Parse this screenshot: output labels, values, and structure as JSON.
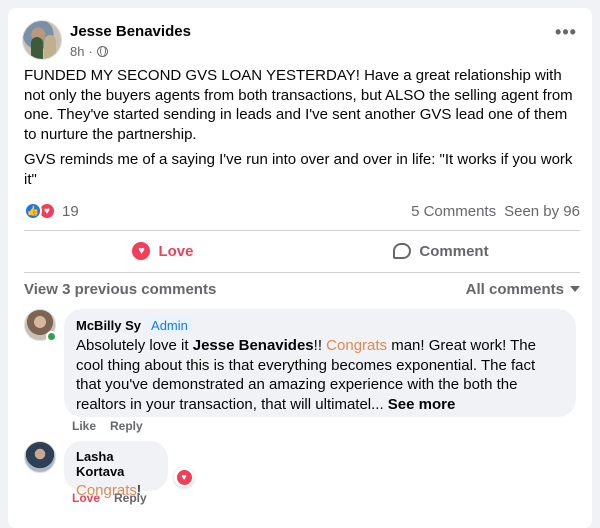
{
  "post": {
    "author": "Jesse Benavides",
    "time": "8h",
    "audience_icon": "globe-icon",
    "more_label": "•••",
    "paragraph1": "FUNDED MY SECOND GVS LOAN YESTERDAY! Have a great relationship with not only the buyers agents from both transactions, but ALSO the selling agent from one. They've started sending in leads and I've sent another GVS lead one of them to nurture the partnership.",
    "paragraph2": "GVS reminds me of a saying I've run into over and over in life: \"It works if you work it\""
  },
  "stats": {
    "reaction_count": "19",
    "comments": "5 Comments",
    "seen_by": "Seen by 96"
  },
  "actions": {
    "love_label": "Love",
    "comment_label": "Comment"
  },
  "comments_header": {
    "view_previous": "View 3 previous comments",
    "filter": "All comments"
  },
  "comments": [
    {
      "author": "McBilly Sy",
      "badge": "Admin",
      "text_prefix": "Absolutely love it ",
      "mention": "Jesse Benavides",
      "text_mid": "!! ",
      "highlight": "Congrats",
      "text_rest": " man! Great work! The cool thing about this is that everything becomes exponential. The fact that you've demonstrated an amazing experience with the both the realtors in your transaction, that will ultimatel...",
      "see_more": "See more",
      "like_label": "Like",
      "reply_label": "Reply"
    },
    {
      "author": "Lasha Kortava",
      "highlight": "Congrats",
      "text_rest": "!",
      "love_label": "Love",
      "reply_label": "Reply"
    }
  ],
  "colors": {
    "brand_blue": "#1877f2",
    "love_red": "#f33e58",
    "congrats_orange": "#e38850",
    "muted": "#65676b"
  }
}
